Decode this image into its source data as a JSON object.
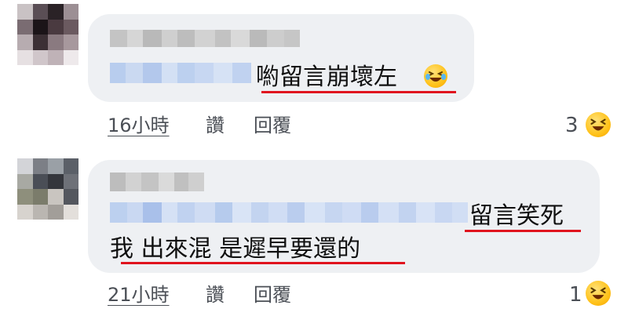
{
  "comments": [
    {
      "text_line1": "喲留言崩壞左",
      "time": "16小時",
      "like_label": "讚",
      "reply_label": "回覆",
      "reaction_count": "3",
      "reaction_icon": "laughing-face-icon"
    },
    {
      "text_line1": "留言笑死",
      "text_line2": "我 出來混 是遲早要還的",
      "time": "21小時",
      "like_label": "讚",
      "reply_label": "回覆",
      "reaction_count": "1",
      "reaction_icon": "laughing-face-icon"
    }
  ],
  "colors": {
    "bubble": "#eef0f3",
    "underline": "#e0141e",
    "meta_text": "#4b4f56"
  }
}
